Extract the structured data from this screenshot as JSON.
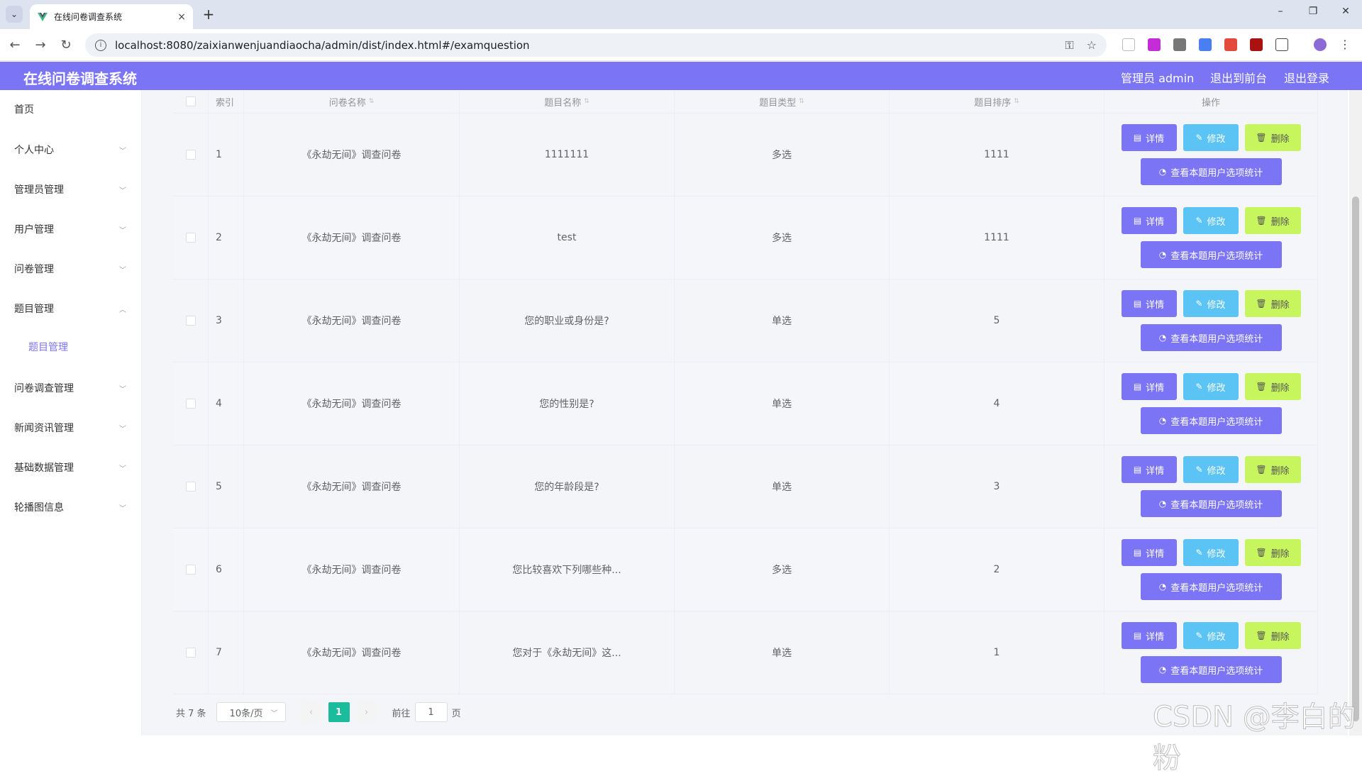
{
  "browser": {
    "tab_title": "在线问卷调查系统",
    "url": "localhost:8080/zaixianwenjuandiaocha/admin/dist/index.html#/examquestion",
    "new_tab": "+",
    "close_tab": "×",
    "back": "←",
    "forward": "→",
    "reload": "↻",
    "minimize": "–",
    "restore": "❐",
    "close": "✕"
  },
  "header": {
    "title": "在线问卷调查系统",
    "user": "管理员 admin",
    "front": "退出到前台",
    "logout": "退出登录"
  },
  "sidebar": {
    "items": [
      {
        "label": "首页"
      },
      {
        "label": "个人中心"
      },
      {
        "label": "管理员管理"
      },
      {
        "label": "用户管理"
      },
      {
        "label": "问卷管理"
      },
      {
        "label": "题目管理"
      },
      {
        "label": "问卷调查管理"
      },
      {
        "label": "新闻资讯管理"
      },
      {
        "label": "基础数据管理"
      },
      {
        "label": "轮播图信息"
      }
    ],
    "sub_item": "题目管理"
  },
  "table": {
    "headers": {
      "index": "索引",
      "survey": "问卷名称",
      "name": "题目名称",
      "type": "题目类型",
      "sort": "题目排序",
      "ops": "操作"
    },
    "buttons": {
      "detail": "详情",
      "edit": "修改",
      "delete": "删除",
      "stat": "查看本题用户选项统计"
    },
    "rows": [
      {
        "index": "1",
        "survey": "《永劫无间》调查问卷",
        "name": "1111111",
        "type": "多选",
        "sort": "1111"
      },
      {
        "index": "2",
        "survey": "《永劫无间》调查问卷",
        "name": "test",
        "type": "多选",
        "sort": "1111"
      },
      {
        "index": "3",
        "survey": "《永劫无间》调查问卷",
        "name": "您的职业或身份是?",
        "type": "单选",
        "sort": "5"
      },
      {
        "index": "4",
        "survey": "《永劫无间》调查问卷",
        "name": "您的性别是?",
        "type": "单选",
        "sort": "4"
      },
      {
        "index": "5",
        "survey": "《永劫无间》调查问卷",
        "name": "您的年龄段是?",
        "type": "单选",
        "sort": "3"
      },
      {
        "index": "6",
        "survey": "《永劫无间》调查问卷",
        "name": "您比较喜欢下列哪些种...",
        "type": "多选",
        "sort": "2"
      },
      {
        "index": "7",
        "survey": "《永劫无间》调查问卷",
        "name": "您对于《永劫无间》这...",
        "type": "单选",
        "sort": "1"
      }
    ]
  },
  "pagination": {
    "total": "共 7 条",
    "page_size": "10条/页",
    "current": "1",
    "goto_prefix": "前往",
    "goto_value": "1",
    "goto_suffix": "页"
  },
  "watermark": "CSDN @李白的粉",
  "colors": {
    "accent": "#7b74f5",
    "edit": "#5bc4f5",
    "delete": "#c6f55e",
    "page_active": "#1abc9c"
  }
}
